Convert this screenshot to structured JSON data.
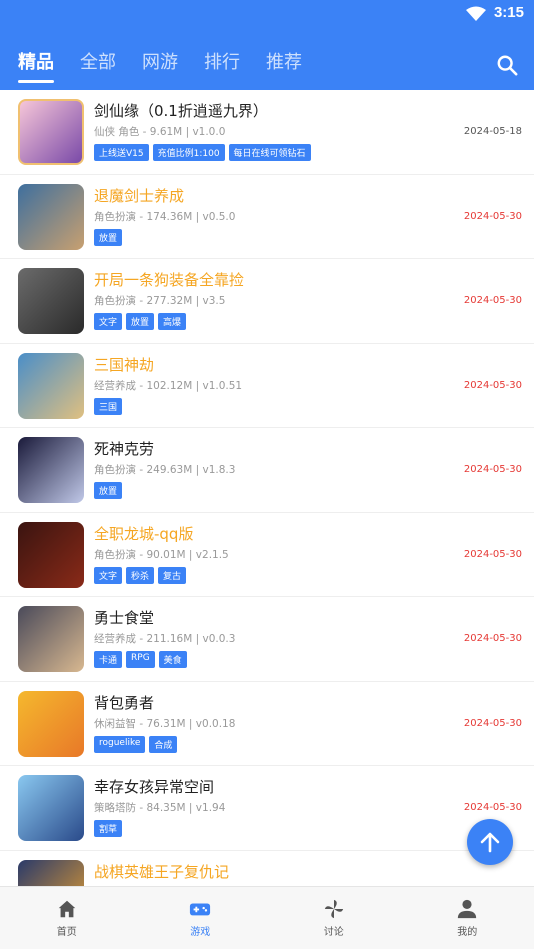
{
  "status_bar": {
    "time": "3:15"
  },
  "tabs": [
    {
      "label": "精品",
      "active": true
    },
    {
      "label": "全部"
    },
    {
      "label": "网游"
    },
    {
      "label": "排行"
    },
    {
      "label": "推荐"
    }
  ],
  "games": [
    {
      "title": "剑仙缘（0.1折逍遥九界）",
      "title_color": "normal",
      "meta": "仙侠 角色 - 9.61M | v1.0.0",
      "tags": [
        "上线送V15",
        "充值比例1:100",
        "每日在线可领钻石"
      ],
      "date": "2024-05-18",
      "date_color": "gray",
      "icon_colors": [
        "#f6c6d8",
        "#7a4aa8"
      ]
    },
    {
      "title": "退魔剑士养成",
      "title_color": "gold",
      "meta": "角色扮演 - 174.36M | v0.5.0",
      "tags": [
        "放置"
      ],
      "date": "2024-05-30",
      "date_color": "red",
      "icon_colors": [
        "#3e6f9e",
        "#c8a070"
      ]
    },
    {
      "title": "开局一条狗装备全靠捡",
      "title_color": "gold",
      "meta": "角色扮演 - 277.32M | v3.5",
      "tags": [
        "文字",
        "放置",
        "高爆"
      ],
      "date": "2024-05-30",
      "date_color": "red",
      "icon_colors": [
        "#6b6b6b",
        "#2a2a2a"
      ]
    },
    {
      "title": "三国神劫",
      "title_color": "gold",
      "meta": "经营养成 - 102.12M | v1.0.51",
      "tags": [
        "三国"
      ],
      "date": "2024-05-30",
      "date_color": "red",
      "icon_colors": [
        "#4a8ec8",
        "#e0c080"
      ]
    },
    {
      "title": "死神克劳",
      "title_color": "normal",
      "meta": "角色扮演 - 249.63M | v1.8.3",
      "tags": [
        "放置"
      ],
      "date": "2024-05-30",
      "date_color": "red",
      "icon_colors": [
        "#1a1a3a",
        "#c0c8e8"
      ]
    },
    {
      "title": "全职龙城-qq版",
      "title_color": "gold",
      "meta": "角色扮演 - 90.01M | v2.1.5",
      "tags": [
        "文字",
        "秒杀",
        "复古"
      ],
      "date": "2024-05-30",
      "date_color": "red",
      "icon_colors": [
        "#3a1410",
        "#8a2a18"
      ]
    },
    {
      "title": "勇士食堂",
      "title_color": "normal",
      "meta": "经营养成 - 211.16M | v0.0.3",
      "tags": [
        "卡通",
        "RPG",
        "美食"
      ],
      "date": "2024-05-30",
      "date_color": "red",
      "icon_colors": [
        "#4a4a5a",
        "#d8b890"
      ]
    },
    {
      "title": "背包勇者",
      "title_color": "normal",
      "meta": "休闲益智 - 76.31M | v0.0.18",
      "tags": [
        "roguelike",
        "合成"
      ],
      "date": "2024-05-30",
      "date_color": "red",
      "icon_colors": [
        "#f5b82e",
        "#e87828"
      ]
    },
    {
      "title": "幸存女孩异常空间",
      "title_color": "normal",
      "meta": "策略塔防 - 84.35M | v1.94",
      "tags": [
        "割草"
      ],
      "date": "2024-05-30",
      "date_color": "red",
      "icon_colors": [
        "#8ac8f0",
        "#2a4a8a"
      ]
    },
    {
      "title": "战棋英雄王子复仇记",
      "title_color": "gold",
      "meta": "",
      "tags": [],
      "date": "",
      "date_color": "red",
      "icon_colors": [
        "#2a3a6a",
        "#e8a030"
      ]
    }
  ],
  "bottom_nav": [
    {
      "label": "首页",
      "icon": "home-icon",
      "active": false
    },
    {
      "label": "游戏",
      "icon": "gamepad-icon",
      "active": true
    },
    {
      "label": "讨论",
      "icon": "pinwheel-icon",
      "active": false
    },
    {
      "label": "我的",
      "icon": "person-icon",
      "active": false
    }
  ],
  "colors": {
    "primary": "#3b82f6",
    "gold": "#f5a623",
    "date_red": "#e53935"
  }
}
